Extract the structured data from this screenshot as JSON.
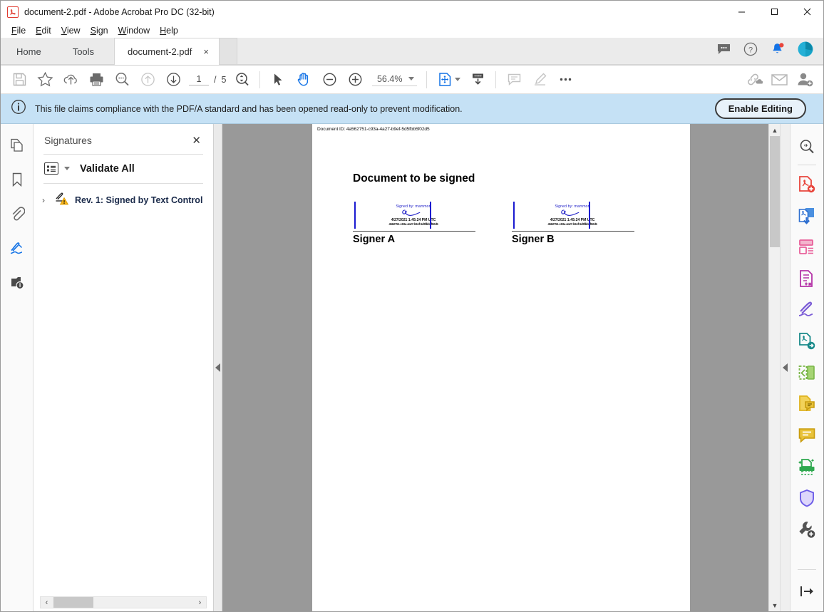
{
  "window": {
    "title": "document-2.pdf - Adobe Acrobat Pro DC (32-bit)",
    "icon": "pdf-app-icon",
    "minimize": "minimize",
    "maximize": "maximize",
    "close": "close"
  },
  "menubar": [
    {
      "label": "File",
      "accel": "F"
    },
    {
      "label": "Edit",
      "accel": "E"
    },
    {
      "label": "View",
      "accel": "V"
    },
    {
      "label": "Sign",
      "accel": "S"
    },
    {
      "label": "Window",
      "accel": "W"
    },
    {
      "label": "Help",
      "accel": "H"
    }
  ],
  "tabbar": {
    "home": "Home",
    "tools": "Tools",
    "document_tab": "document-2.pdf",
    "document_tab_close": "×",
    "right_icons": [
      "comment-icon",
      "help-icon",
      "notification-bell-icon",
      "account-avatar"
    ]
  },
  "toolbar": {
    "icons_left": [
      "save-icon",
      "star-icon",
      "upload-cloud-icon",
      "print-icon",
      "search-icon",
      "previous-page-icon",
      "next-page-icon"
    ],
    "page_current": "1",
    "page_separator": "/",
    "page_total": "5",
    "zoom_to_icon": "zoom-to-page-level-icon",
    "icons_mid": [
      "select-tool-icon",
      "hand-tool-icon",
      "zoom-out-icon",
      "zoom-in-icon"
    ],
    "zoom_value": "56.4%",
    "fit_page_icon": "fit-page-icon",
    "scroll_mode_icon": "scroll-mode-icon",
    "icons_right": [
      "add-comment-icon",
      "highlight-icon",
      "more-tools-icon",
      "share-link-icon",
      "email-icon",
      "add-person-icon"
    ]
  },
  "notification": {
    "icon": "info-icon",
    "message": "This file claims compliance with the PDF/A standard and has been opened read-only to prevent modification.",
    "button": "Enable Editing"
  },
  "left_rail": [
    {
      "name": "page-thumbnails",
      "active": false
    },
    {
      "name": "bookmarks",
      "active": false
    },
    {
      "name": "attachments",
      "active": false
    },
    {
      "name": "signatures",
      "active": true
    },
    {
      "name": "document-info",
      "active": false
    }
  ],
  "signatures_panel": {
    "title": "Signatures",
    "close": "✕",
    "validate_all": "Validate All",
    "options_icon": "list-options-icon",
    "tree": [
      {
        "expand": "›",
        "icon": "signature-warning-icon",
        "label": "Rev. 1: Signed by Text Control"
      }
    ],
    "scrollbar": {
      "left_arrow": "‹",
      "right_arrow": "›"
    }
  },
  "document": {
    "doc_id_label": "Document ID:",
    "doc_id_value": "4a562751-c93a-4a27-b9ef-5d5fbb5f02d5",
    "heading": "Document to be signed",
    "signatures": [
      {
        "signed_by": "Signed by: mammon",
        "timestamp": "4/27/2021 1:45:24 PM UTC",
        "hash": "4562751-c93a-4a27-b9ef-5d5fbb5f02d5",
        "signer_label": "Signer A"
      },
      {
        "signed_by": "Signed by: mammon",
        "timestamp": "4/27/2021 1:45:24 PM UTC",
        "hash": "4562751-c93a-4a27-b9ef-5d5fbb5f02d5",
        "signer_label": "Signer  B"
      }
    ]
  },
  "right_rail": [
    {
      "name": "search-zoom-tool",
      "color": "#4a4a4a"
    },
    {
      "name": "create-pdf-tool",
      "color": "#e8453c"
    },
    {
      "name": "export-pdf-tool",
      "color": "#2f6fd0"
    },
    {
      "name": "edit-pdf-tool",
      "color": "#e8609a"
    },
    {
      "name": "combine-files-tool",
      "color": "#b535a8"
    },
    {
      "name": "fill-and-sign-tool",
      "color": "#7b5cd6"
    },
    {
      "name": "send-for-signature-tool",
      "color": "#1a8a8a"
    },
    {
      "name": "organize-pages-tool",
      "color": "#7ab648"
    },
    {
      "name": "comment-doc-tool",
      "color": "#e0b421"
    },
    {
      "name": "comment-tool",
      "color": "#e0b421"
    },
    {
      "name": "scan-and-ocr-tool",
      "color": "#2fa84f"
    },
    {
      "name": "protect-tool",
      "color": "#6c5ce7"
    },
    {
      "name": "more-tools",
      "color": "#555555"
    },
    {
      "name": "expand-panel",
      "color": "#333333"
    }
  ],
  "colors": {
    "notification_bg": "#c5e1f5",
    "accent_blue": "#0f6cbd",
    "page_backdrop": "#999999",
    "signature_blue": "#1a1ad0"
  }
}
